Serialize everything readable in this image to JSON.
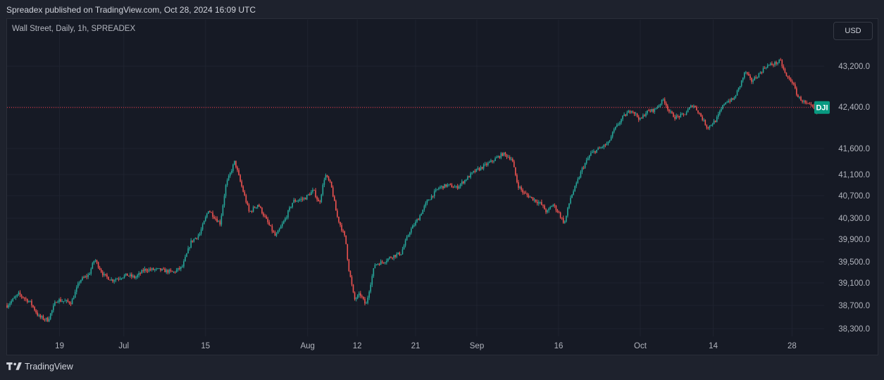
{
  "header": {
    "published": "Spreadex published on TradingView.com, Oct 28, 2024 16:09 UTC"
  },
  "chart_header": {
    "symbol": "Wall Street, Daily, 1h, SPREADEX",
    "currency": "USD"
  },
  "footer": {
    "brand": "TradingView"
  },
  "colors": {
    "up": "#26a69a",
    "down": "#ef5350",
    "background": "#161a25",
    "grid": "#1f2330",
    "price_line": "#f23645",
    "label_bg": "#089981"
  },
  "chart_data": {
    "type": "line",
    "title": "Wall Street, Daily, 1h, SPREADEX",
    "series": [
      {
        "name": "DJI",
        "values": [
          [
            0,
            38700
          ],
          [
            4,
            38900
          ],
          [
            8,
            38750
          ],
          [
            11,
            38500
          ],
          [
            14,
            38450
          ],
          [
            17,
            38800
          ],
          [
            22,
            38750
          ],
          [
            25,
            39150
          ],
          [
            28,
            39250
          ],
          [
            30,
            39550
          ],
          [
            33,
            39250
          ],
          [
            36,
            39150
          ],
          [
            41,
            39250
          ],
          [
            44,
            39200
          ],
          [
            47,
            39350
          ],
          [
            52,
            39350
          ],
          [
            57,
            39300
          ],
          [
            60,
            39400
          ],
          [
            63,
            39850
          ],
          [
            66,
            40000
          ],
          [
            69,
            40450
          ],
          [
            73,
            40200
          ],
          [
            75,
            40900
          ],
          [
            78,
            41350
          ],
          [
            80,
            40950
          ],
          [
            83,
            40400
          ],
          [
            86,
            40550
          ],
          [
            89,
            40250
          ],
          [
            92,
            39950
          ],
          [
            95,
            40250
          ],
          [
            98,
            40600
          ],
          [
            102,
            40650
          ],
          [
            105,
            40800
          ],
          [
            107,
            40550
          ],
          [
            109,
            41100
          ],
          [
            111,
            40900
          ],
          [
            113,
            40350
          ],
          [
            116,
            39900
          ],
          [
            117,
            39400
          ],
          [
            119,
            38800
          ],
          [
            121,
            38900
          ],
          [
            123,
            38700
          ],
          [
            126,
            39450
          ],
          [
            129,
            39500
          ],
          [
            132,
            39600
          ],
          [
            135,
            39650
          ],
          [
            138,
            40050
          ],
          [
            141,
            40300
          ],
          [
            144,
            40600
          ],
          [
            148,
            40850
          ],
          [
            151,
            40900
          ],
          [
            154,
            40850
          ],
          [
            157,
            41000
          ],
          [
            160,
            41150
          ],
          [
            163,
            41250
          ],
          [
            166,
            41350
          ],
          [
            170,
            41500
          ],
          [
            173,
            41400
          ],
          [
            175,
            40900
          ],
          [
            177,
            40750
          ],
          [
            180,
            40650
          ],
          [
            183,
            40550
          ],
          [
            185,
            40400
          ],
          [
            187,
            40550
          ],
          [
            189,
            40400
          ],
          [
            191,
            40200
          ],
          [
            193,
            40650
          ],
          [
            195,
            40900
          ],
          [
            197,
            41200
          ],
          [
            200,
            41500
          ],
          [
            203,
            41600
          ],
          [
            206,
            41700
          ],
          [
            208,
            41950
          ],
          [
            211,
            42200
          ],
          [
            214,
            42350
          ],
          [
            217,
            42150
          ],
          [
            219,
            42300
          ],
          [
            222,
            42350
          ],
          [
            225,
            42550
          ],
          [
            227,
            42300
          ],
          [
            229,
            42200
          ],
          [
            232,
            42250
          ],
          [
            235,
            42450
          ],
          [
            237,
            42300
          ],
          [
            240,
            42000
          ],
          [
            243,
            42150
          ],
          [
            246,
            42500
          ],
          [
            249,
            42550
          ],
          [
            251,
            42800
          ],
          [
            253,
            43100
          ],
          [
            255,
            42900
          ],
          [
            257,
            43000
          ],
          [
            260,
            43200
          ],
          [
            263,
            43250
          ],
          [
            265,
            43300
          ],
          [
            267,
            43000
          ],
          [
            269,
            42900
          ],
          [
            271,
            42600
          ],
          [
            274,
            42450
          ],
          [
            276,
            42400
          ],
          [
            278,
            42250
          ]
        ]
      }
    ],
    "price_label": {
      "name": "DJI",
      "value": 42390
    },
    "x_ticks": [
      {
        "x": 18,
        "label": "19"
      },
      {
        "x": 40,
        "label": "Jul"
      },
      {
        "x": 68,
        "label": "15"
      },
      {
        "x": 103,
        "label": "Aug"
      },
      {
        "x": 120,
        "label": "12"
      },
      {
        "x": 140,
        "label": "21"
      },
      {
        "x": 161,
        "label": "Sep"
      },
      {
        "x": 189,
        "label": "16"
      },
      {
        "x": 217,
        "label": "Oct"
      },
      {
        "x": 242,
        "label": "14"
      },
      {
        "x": 269,
        "label": "28"
      }
    ],
    "y_ticks": [
      "43,200.0",
      "42,400.0",
      "41,600.0",
      "41,100.0",
      "40,700.0",
      "40,300.0",
      "39,900.0",
      "39,500.0",
      "39,100.0",
      "38,700.0",
      "38,300.0"
    ],
    "ylim": [
      38300,
      43200
    ],
    "grid": true
  }
}
